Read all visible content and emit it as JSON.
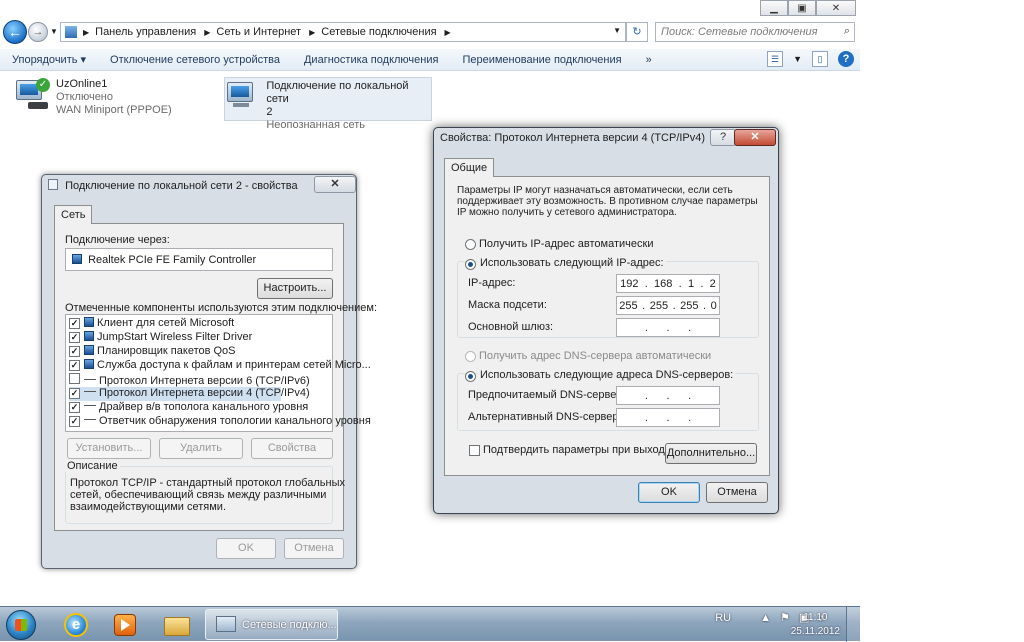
{
  "explorer": {
    "breadcrumbs": [
      "Панель управления",
      "Сеть и Интернет",
      "Сетевые подключения"
    ],
    "search_placeholder": "Поиск: Сетевые подключения",
    "commands": [
      "Упорядочить ▾",
      "Отключение сетевого устройства",
      "Диагностика подключения",
      "Переименование подключения",
      "»"
    ],
    "connections": [
      {
        "name": "UzOnline1",
        "status": "Отключено",
        "device": "WAN Miniport (PPPOE)"
      },
      {
        "name": "Подключение по локальной сети",
        "name2": "2",
        "status": "Неопознанная сеть"
      }
    ]
  },
  "props_dialog": {
    "title": "Подключение по локальной сети 2 - свойства",
    "tab": "Сеть",
    "connect_using_label": "Подключение через:",
    "adapter": "Realtek PCIe FE Family Controller",
    "configure_button": "Настроить...",
    "components_label": "Отмеченные компоненты используются этим подключением:",
    "components": [
      {
        "label": "Клиент для сетей Microsoft",
        "checked": "✓"
      },
      {
        "label": "JumpStart Wireless Filter Driver",
        "checked": "✓"
      },
      {
        "label": "Планировщик пакетов QoS",
        "checked": "✓"
      },
      {
        "label": "Служба доступа к файлам и принтерам сетей Micro...",
        "checked": "✓"
      },
      {
        "label": "Протокол Интернета версии 6 (TCP/IPv6)",
        "checked": ""
      },
      {
        "label": "Протокол Интернета версии 4 (TCP/IPv4)",
        "checked": "✓"
      },
      {
        "label": "Драйвер в/в тополога канального уровня",
        "checked": "✓"
      },
      {
        "label": "Ответчик обнаружения топологии канального уровня",
        "checked": "✓"
      }
    ],
    "install_button": "Установить...",
    "uninstall_button": "Удалить",
    "properties_button": "Свойства",
    "description_title": "Описание",
    "description_text": [
      "Протокол TCP/IP - стандартный протокол глобальных",
      "сетей, обеспечивающий связь между различными",
      "взаимодействующими сетями."
    ],
    "ok_button": "OK",
    "cancel_button": "Отмена"
  },
  "ipv4_dialog": {
    "title": "Свойства: Протокол Интернета версии 4 (TCP/IPv4)",
    "tab": "Общие",
    "intro": [
      "Параметры IP могут назначаться автоматически, если сеть",
      "поддерживает эту возможность. В противном случае параметры",
      "IP можно получить у сетевого администратора."
    ],
    "auto_ip": "Получить IP-адрес автоматически",
    "manual_ip": "Использовать следующий IP-адрес:",
    "ip_label": "IP-адрес:",
    "ip": [
      "192",
      "168",
      "1",
      "2"
    ],
    "mask_label": "Маска подсети:",
    "mask": [
      "255",
      "255",
      "255",
      "0"
    ],
    "gateway_label": "Основной шлюз:",
    "auto_dns": "Получить адрес DNS-сервера автоматически",
    "manual_dns": "Использовать следующие адреса DNS-серверов:",
    "preferred_dns_label": "Предпочитаемый DNS-сервер:",
    "alternate_dns_label": "Альтернативный DNS-сервер:",
    "validate_label": "Подтвердить параметры при выходе",
    "advanced_button": "Дополнительно...",
    "ok_button": "OK",
    "cancel_button": "Отмена",
    "dot": "."
  },
  "taskbar": {
    "active_window": "Сетевые подклю...",
    "lang": "RU",
    "time": "11:10",
    "date": "25.11.2012"
  }
}
